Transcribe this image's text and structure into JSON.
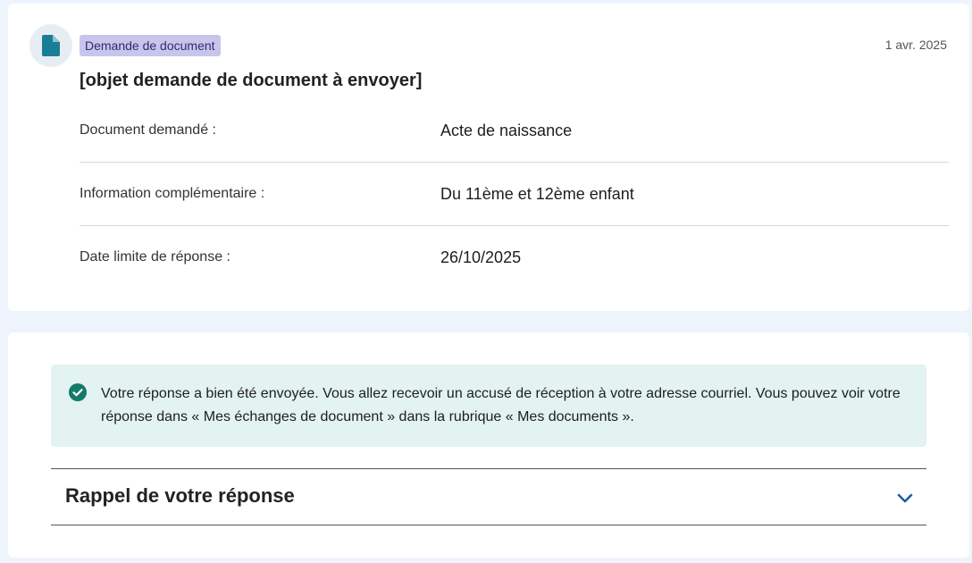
{
  "request": {
    "tag": "Demande de document",
    "date": "1 avr. 2025",
    "title": "[objet demande de document à envoyer]",
    "details": [
      {
        "label": "Document demandé :",
        "value": "Acte de naissance"
      },
      {
        "label": "Information complémentaire :",
        "value": "Du 11ème et 12ème enfant"
      },
      {
        "label": "Date limite de réponse :",
        "value": "26/10/2025"
      }
    ]
  },
  "confirmation": {
    "message": "Votre réponse a bien été envoyée. Vous allez recevoir un accusé de réception à votre adresse courriel. Vous pouvez voir votre réponse dans « Mes échanges de document » dans la rubrique « Mes documents »."
  },
  "accordion": {
    "title": "Rappel de votre réponse",
    "expanded": false
  },
  "icons": {
    "document": "document-icon",
    "success": "check-circle-icon",
    "chevron": "chevron-down-icon"
  },
  "colors": {
    "tag_background": "#c8c5ec",
    "document_icon": "#1a7e96",
    "success_icon": "#147a6a",
    "success_background": "#e2f3f1",
    "chevron": "#1d5fa8"
  }
}
